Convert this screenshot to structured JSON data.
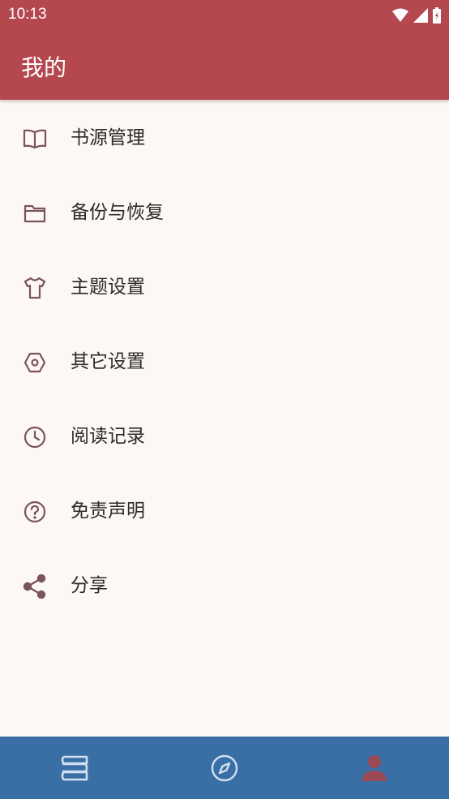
{
  "status_bar": {
    "time": "10:13"
  },
  "app_bar": {
    "title": "我的"
  },
  "menu": {
    "items": [
      {
        "label": "书源管理",
        "icon": "book-open-icon"
      },
      {
        "label": "备份与恢复",
        "icon": "folder-icon"
      },
      {
        "label": "主题设置",
        "icon": "tshirt-icon"
      },
      {
        "label": "其它设置",
        "icon": "hexagon-settings-icon"
      },
      {
        "label": "阅读记录",
        "icon": "clock-icon"
      },
      {
        "label": "免责声明",
        "icon": "help-circle-icon"
      },
      {
        "label": "分享",
        "icon": "share-icon"
      }
    ]
  },
  "bottom_nav": {
    "items": [
      {
        "icon": "bookshelf-icon"
      },
      {
        "icon": "compass-icon"
      },
      {
        "icon": "person-icon",
        "active": true
      }
    ]
  },
  "colors": {
    "accent": "#b5474f",
    "background": "#fdf8f3",
    "nav_background": "#3a6fa6",
    "icon": "#7a545c",
    "nav_icon_inactive": "#cfe0f2",
    "nav_icon_active": "#9a4a55"
  }
}
